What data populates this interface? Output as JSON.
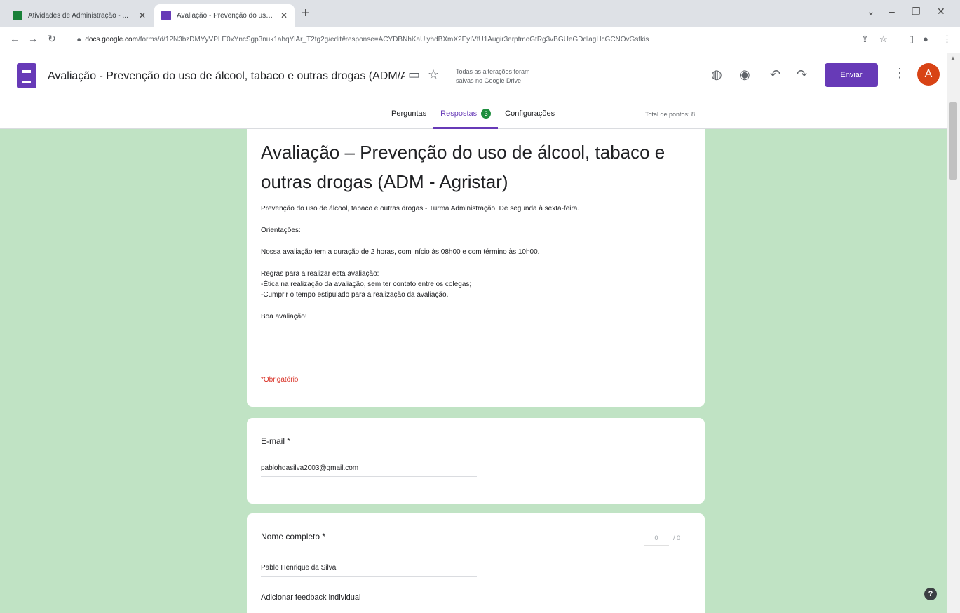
{
  "browser": {
    "tabs": [
      {
        "title": "Atividades de Administração - ...",
        "favicon_color": "#188038"
      },
      {
        "title": "Avaliação - Prevenção do uso de...",
        "favicon_color": "#673ab7"
      }
    ],
    "new_tab_icon": "plus-icon",
    "url_host": "docs.google.com",
    "url_path": "/forms/d/12N3bzDMYyVPLE0xYncSgp3nuk1ahqYlAr_T2tg2g/edit#response=ACYDBNhKaUiyhdBXmX2EyIVfU1Augir3erptmoGtRg3vBGUeGDdlagHcGCNOvGsfkis",
    "window_controls": {
      "minimize": "–",
      "maximize": "❐",
      "close": "✕"
    }
  },
  "header": {
    "doc_title": "Avaliação - Prevenção do uso de álcool, tabaco e outras drogas (ADM/AG",
    "save_status_line1": "Todas as alterações foram",
    "save_status_line2": "salvas no Google Drive",
    "send_label": "Enviar",
    "avatar_initial": "A",
    "brand_color": "#673ab7"
  },
  "form_tabs": {
    "questions": "Perguntas",
    "responses": "Respostas",
    "responses_count": "3",
    "settings": "Configurações",
    "total_points": "Total de pontos: 8"
  },
  "form": {
    "title": "Avaliação – Prevenção do uso de álcool, tabaco e outras drogas (ADM - Agristar)",
    "description": {
      "intro": "Prevenção do uso de álcool, tabaco e outras drogas  - Turma Administração. De segunda à sexta-feira.",
      "orientations": "Orientações:",
      "duration": "Nossa avaliação tem a duração de  2 horas, com início às 08h00 e com término às 10h00.",
      "rules_title": "Regras para a realizar esta avaliação:",
      "rule1": "-Ética na realização da avaliação, sem ter contato entre os colegas;",
      "rule2": "-Cumprir o tempo estipulado para a realização da avaliação.",
      "closing": "Boa avaliação!"
    },
    "required_note": "*Obrigatório",
    "questions": [
      {
        "label": "E-mail *",
        "answer": "pablohdasilva2003@gmail.com"
      },
      {
        "label": "Nome completo *",
        "answer": "Pablo Henrique da Silva",
        "score": "0",
        "max_score": "/ 0",
        "feedback": "Adicionar feedback individual"
      }
    ]
  },
  "colors": {
    "background": "#c0e3c4",
    "accent": "#673ab7",
    "required": "#d93025",
    "badge": "#1e8e3e"
  }
}
